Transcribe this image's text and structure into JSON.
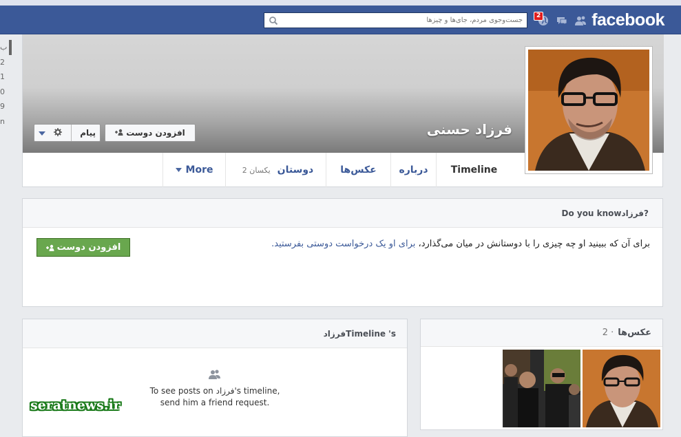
{
  "topbar": {
    "logo": "facebook",
    "search_placeholder": "جست‌وجوی مردم، جای‌ها و چیزها",
    "notifications_count": "2",
    "colors": {
      "bar": "#3b5998"
    }
  },
  "left_strip": [
    "ب",
    "2",
    "1",
    "0",
    "9",
    "n"
  ],
  "profile": {
    "name": "فرزاد حسنی",
    "add_friend_label": "افزودن دوست",
    "message_label": "پیام"
  },
  "tabs": [
    {
      "label": "Timeline"
    },
    {
      "label": "درباره"
    },
    {
      "label": "عکس‌ها"
    },
    {
      "label": "دوستان",
      "sub": "2 یکسان"
    },
    {
      "label": "More"
    }
  ],
  "know": {
    "title": "Do you knowفرزاد?",
    "text": "برای آن که ببینید او چه چیزی را با دوستانش در میان می‌گذارد،",
    "link": "برای او یک درخواست دوستی بفرستید.",
    "button": "افزودن دوست",
    "colors": {
      "button": "#69a74e"
    }
  },
  "timeline": {
    "title": "فرزادTimeline 's",
    "line1": "To see posts on فرزاد's timeline,",
    "line2": "send him a friend request."
  },
  "photos": {
    "title": "عکس‌ها",
    "count": "2 ·"
  },
  "watermark": "seratnews.ir"
}
